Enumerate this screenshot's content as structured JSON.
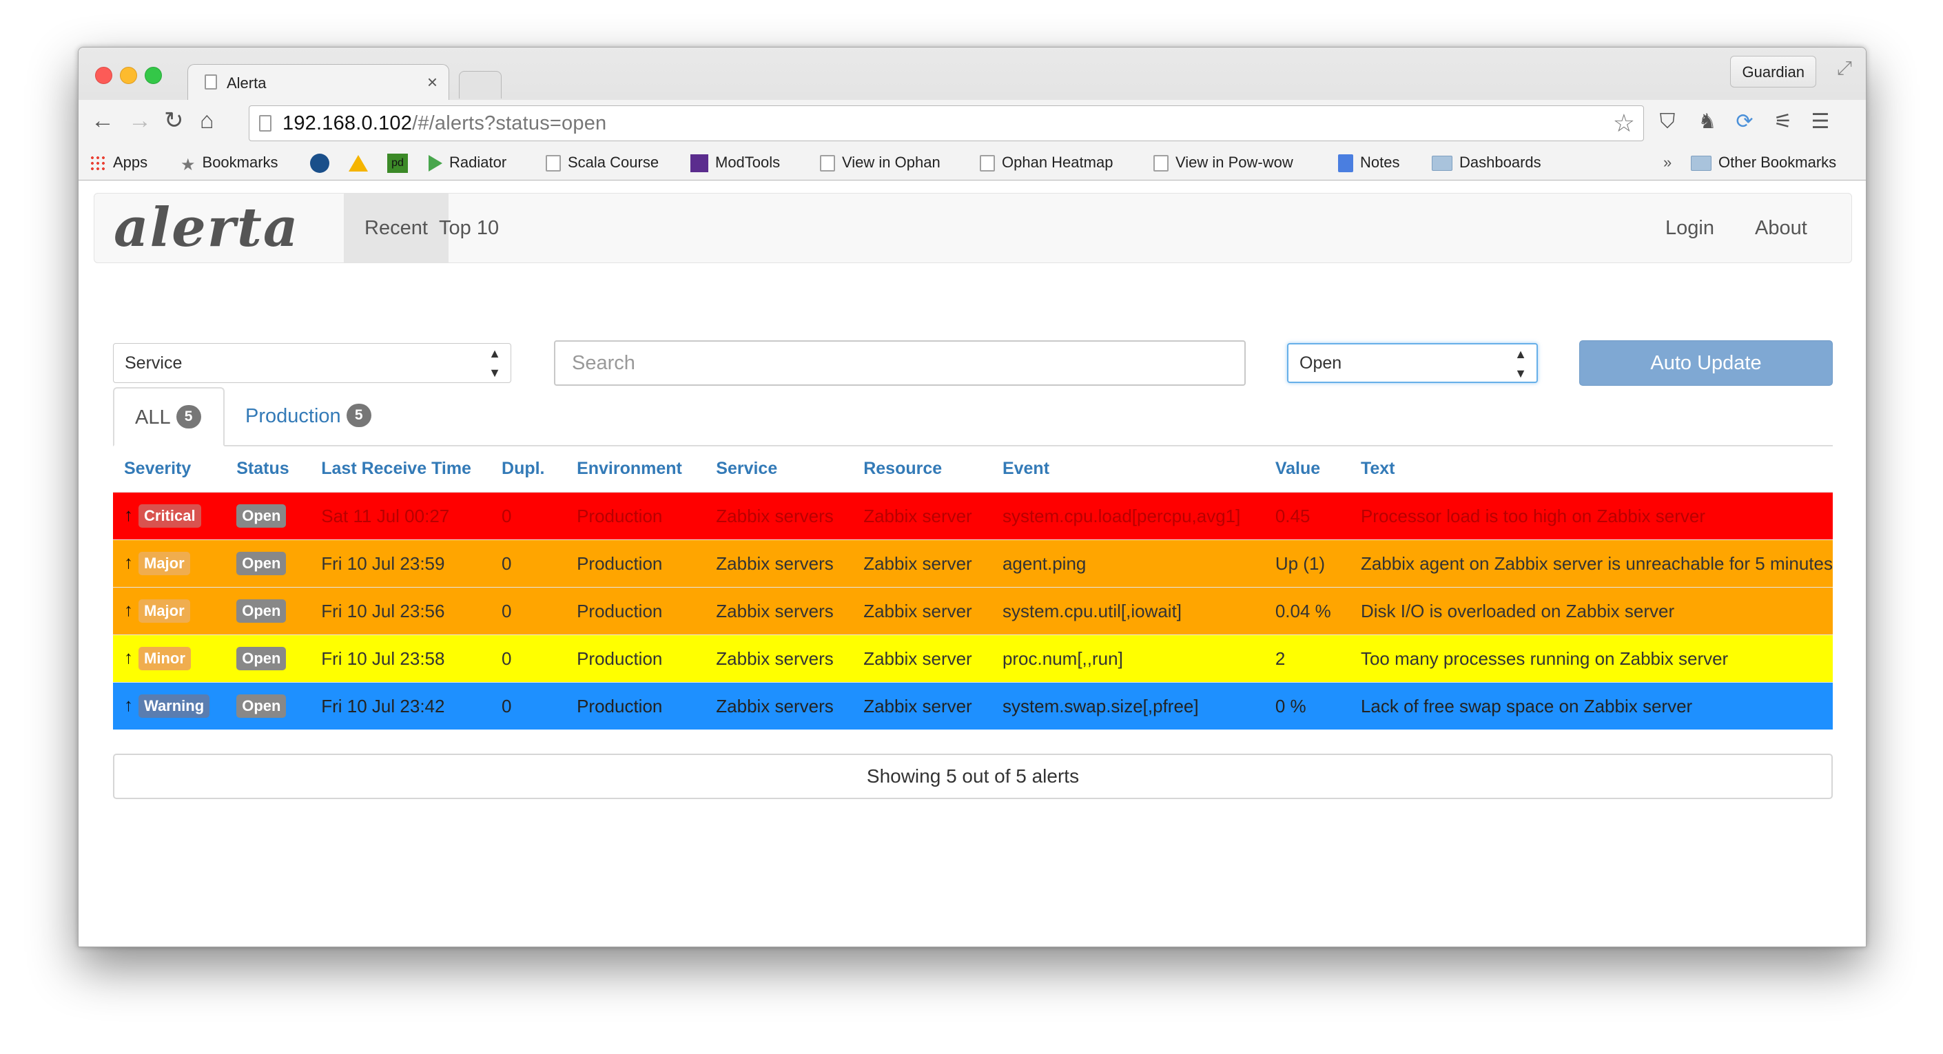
{
  "browser": {
    "tab_title": "Alerta",
    "tab_close": "×",
    "profile": "Guardian",
    "address_host": "192.168.0.102",
    "address_path": "/#/alerts?status=open",
    "bookmarks": [
      {
        "label": "Apps",
        "icon": "apps-icon"
      },
      {
        "label": "Bookmarks",
        "icon": "star-icon"
      },
      {
        "label": "Radiator",
        "icon": "play-icon"
      },
      {
        "label": "Scala Course",
        "icon": "page-icon"
      },
      {
        "label": "ModTools",
        "icon": "modtools-icon"
      },
      {
        "label": "View in Ophan",
        "icon": "page-icon"
      },
      {
        "label": "Ophan Heatmap",
        "icon": "page-icon"
      },
      {
        "label": "View in Pow-wow",
        "icon": "page-icon"
      },
      {
        "label": "Notes",
        "icon": "notes-icon"
      },
      {
        "label": "Dashboards",
        "icon": "folder-icon"
      },
      {
        "label": "Other Bookmarks",
        "icon": "folder-icon"
      }
    ],
    "chevron": "»"
  },
  "app": {
    "brand": "alerta",
    "nav": {
      "recent": "Recent",
      "top10": "Top 10",
      "login": "Login",
      "about": "About"
    },
    "filters": {
      "service_select": "Service",
      "search_placeholder": "Search",
      "status_select": "Open",
      "auto_update": "Auto Update"
    },
    "tabs": [
      {
        "label": "ALL",
        "count": "5"
      },
      {
        "label": "Production",
        "count": "5"
      }
    ],
    "columns": [
      "Severity",
      "Status",
      "Last Receive Time",
      "Dupl.",
      "Environment",
      "Service",
      "Resource",
      "Event",
      "Value",
      "Text"
    ],
    "rows": [
      {
        "severity": "Critical",
        "status": "Open",
        "time": "Sat 11 Jul 00:27",
        "dupl": "0",
        "environment": "Production",
        "service": "Zabbix servers",
        "resource": "Zabbix server",
        "event": "system.cpu.load[percpu,avg1]",
        "value": "0.45",
        "text": "Processor load is too high on Zabbix server"
      },
      {
        "severity": "Major",
        "status": "Open",
        "time": "Fri 10 Jul 23:59",
        "dupl": "0",
        "environment": "Production",
        "service": "Zabbix servers",
        "resource": "Zabbix server",
        "event": "agent.ping",
        "value": "Up (1)",
        "text": "Zabbix agent on Zabbix server is unreachable for 5 minutes"
      },
      {
        "severity": "Major",
        "status": "Open",
        "time": "Fri 10 Jul 23:56",
        "dupl": "0",
        "environment": "Production",
        "service": "Zabbix servers",
        "resource": "Zabbix server",
        "event": "system.cpu.util[,iowait]",
        "value": "0.04 %",
        "text": "Disk I/O is overloaded on Zabbix server"
      },
      {
        "severity": "Minor",
        "status": "Open",
        "time": "Fri 10 Jul 23:58",
        "dupl": "0",
        "environment": "Production",
        "service": "Zabbix servers",
        "resource": "Zabbix server",
        "event": "proc.num[,,run]",
        "value": "2",
        "text": "Too many processes running on Zabbix server"
      },
      {
        "severity": "Warning",
        "status": "Open",
        "time": "Fri 10 Jul 23:42",
        "dupl": "0",
        "environment": "Production",
        "service": "Zabbix servers",
        "resource": "Zabbix server",
        "event": "system.swap.size[,pfree]",
        "value": "0 %",
        "text": "Lack of free swap space on Zabbix server"
      }
    ],
    "footer": "Showing 5 out of 5 alerts"
  },
  "colors": {
    "critical": "#ff0000",
    "major": "#ffa500",
    "minor": "#ffff00",
    "warning": "#1e90ff",
    "link": "#337ab7"
  }
}
